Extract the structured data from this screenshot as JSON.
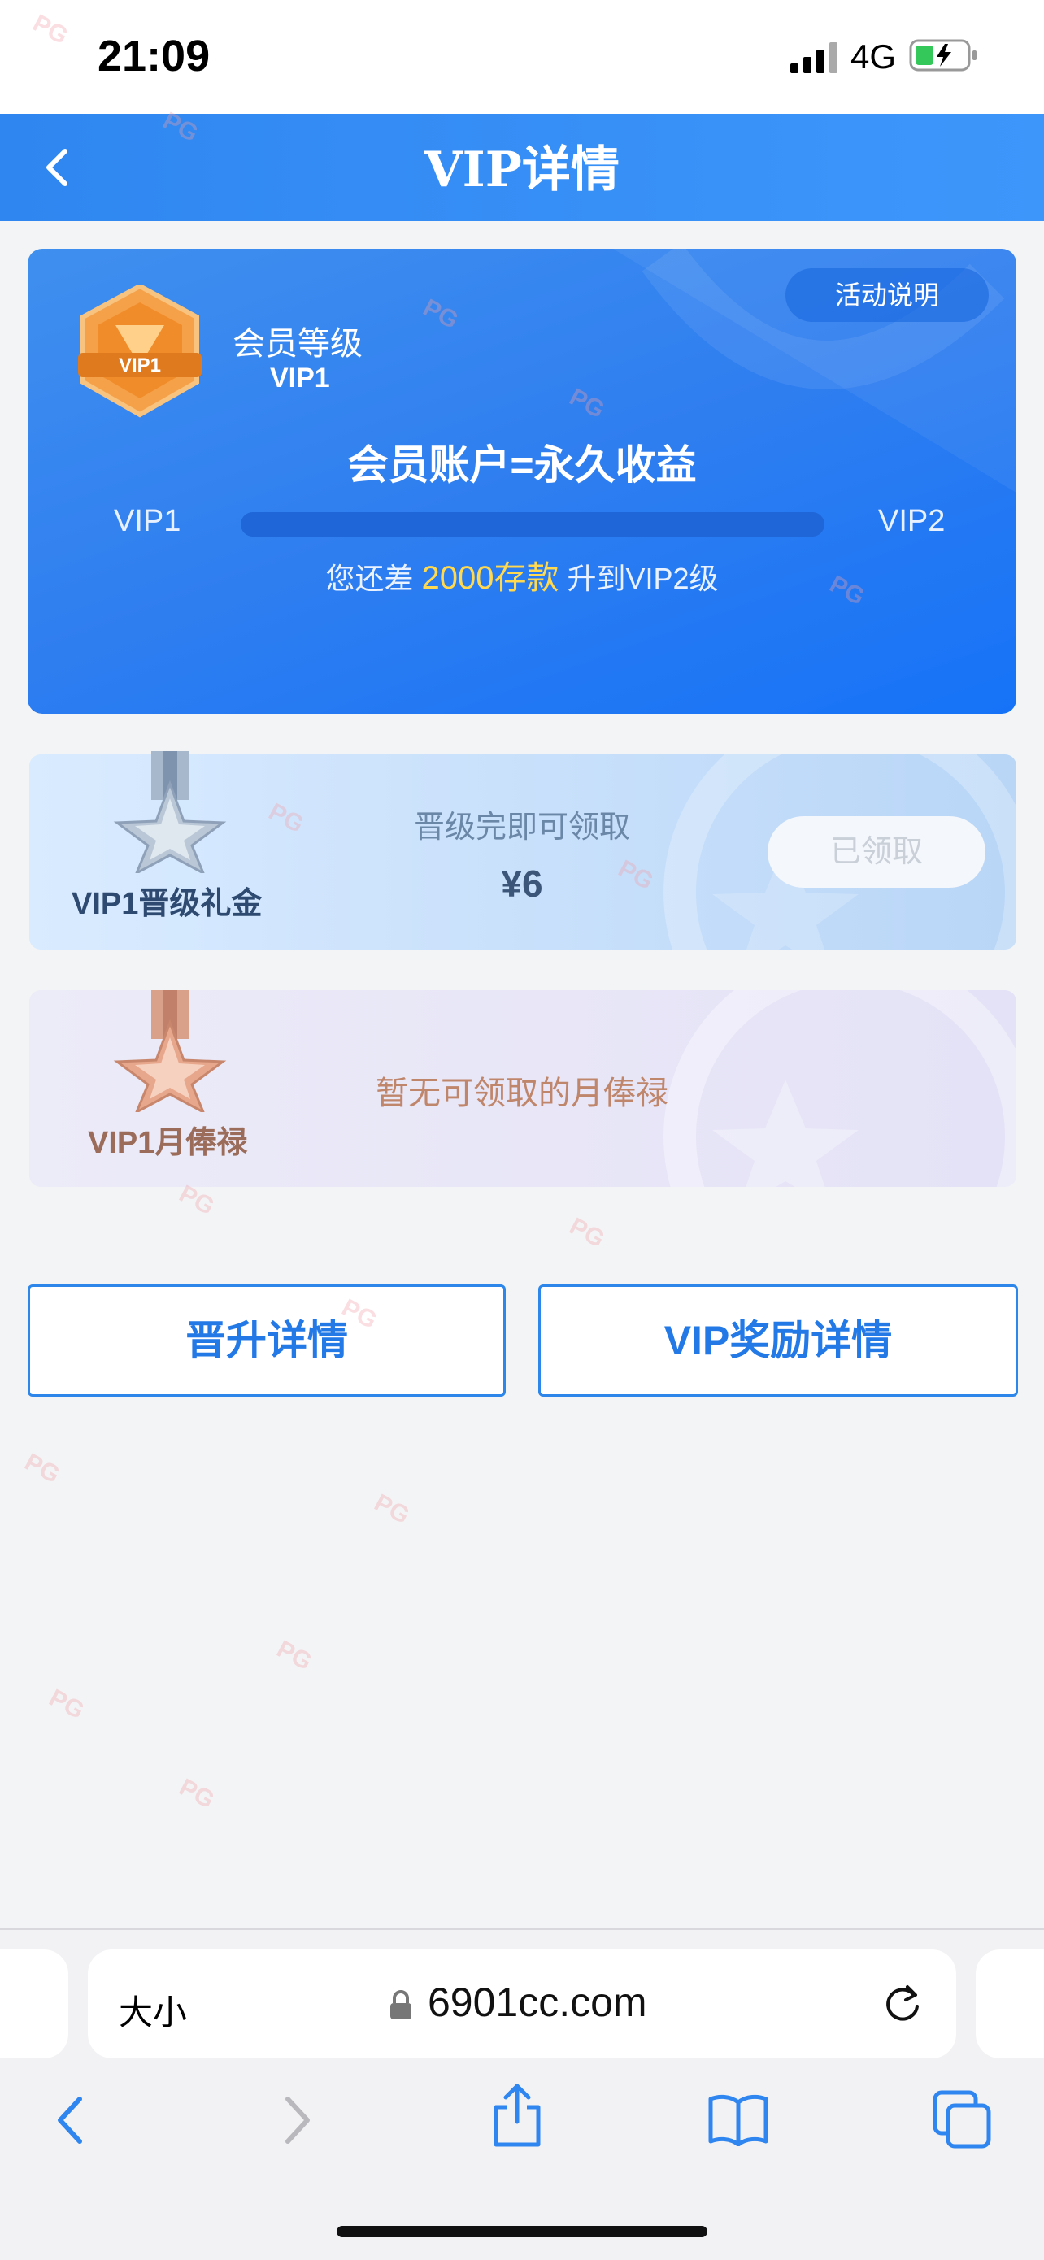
{
  "status_bar": {
    "time": "21:09",
    "network": "4G"
  },
  "header": {
    "title": "VIP详情"
  },
  "vip_card": {
    "level_label": "会员等级",
    "level_value": "VIP1",
    "activity_button": "活动说明",
    "slogan": "会员账户=永久收益",
    "current_level": "VIP1",
    "next_level": "VIP2",
    "progress": 0,
    "diff_prefix": "您还差",
    "diff_amount": "2000存款",
    "diff_suffix": "升到VIP2级",
    "badge_text": "VIP1"
  },
  "gift_card": {
    "name": "VIP1晋级礼金",
    "condition": "晋级完即可领取",
    "amount": "¥6",
    "button": "已领取"
  },
  "salary_card": {
    "name": "VIP1月俸禄",
    "message": "暂无可领取的月俸禄"
  },
  "buttons": {
    "promotion": "晋升详情",
    "reward": "VIP奖励详情"
  },
  "browser": {
    "text_size": "大小",
    "url": "6901cc.com"
  },
  "watermark": "PG",
  "colors": {
    "primary": "#2f86f0",
    "highlight": "#ffd94f"
  }
}
